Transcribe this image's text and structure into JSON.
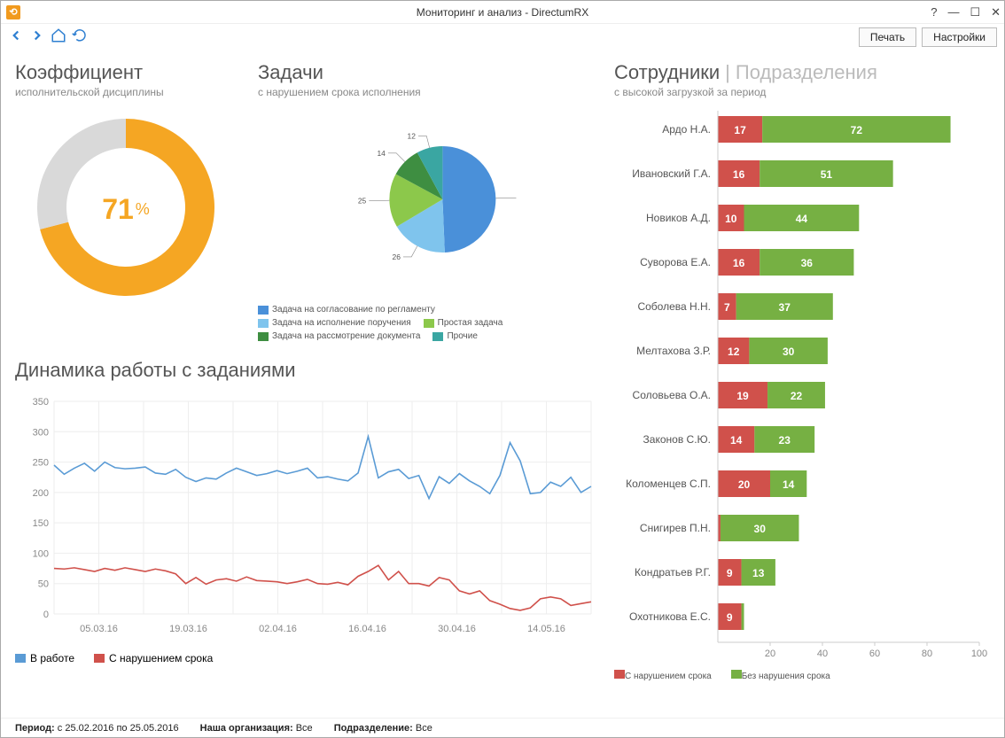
{
  "window": {
    "title": "Мониторинг и анализ - DirectumRX",
    "help": "?"
  },
  "toolbar": {
    "print": "Печать",
    "settings": "Настройки"
  },
  "donut": {
    "title": "Коэффициент",
    "subtitle": "исполнительской дисциплины",
    "value": "71",
    "pct": "%"
  },
  "pie": {
    "title": "Задачи",
    "subtitle": "с нарушением срока исполнения",
    "legend": [
      "Задача на согласование по регламенту",
      "Задача на исполнение поручения",
      "Простая задача",
      "Задача на рассмотрение документа",
      "Прочие"
    ]
  },
  "line": {
    "title": "Динамика работы с заданиями",
    "legend1": "В работе",
    "legend2": "С нарушением срока"
  },
  "employees": {
    "tab1": "Сотрудники",
    "tab2": "Подразделения",
    "subtitle": "с высокой загрузкой за период",
    "legend1": "С нарушением срока",
    "legend2": "Без нарушения срока"
  },
  "status": {
    "period_label": "Период:",
    "period_value": "с 25.02.2016 по 25.05.2016",
    "org_label": "Наша организация:",
    "org_value": "Все",
    "dept_label": "Подразделение:",
    "dept_value": "Все"
  },
  "chart_data": {
    "donut": {
      "type": "pie",
      "value": 71,
      "title": "Коэффициент исполнительской дисциплины"
    },
    "tasks_pie": {
      "type": "pie",
      "title": "Задачи с нарушением срока исполнения",
      "series": [
        {
          "name": "Задача на согласование по регламенту",
          "value": 75,
          "color": "#4a90d9"
        },
        {
          "name": "Задача на исполнение поручения",
          "value": 26,
          "color": "#7fc4ed"
        },
        {
          "name": "Простая задача",
          "value": 25,
          "color": "#8cc84b"
        },
        {
          "name": "Задача на рассмотрение документа",
          "value": 14,
          "color": "#3e8e41"
        },
        {
          "name": "Прочие",
          "value": 12,
          "color": "#3aa6a2"
        }
      ]
    },
    "dynamics": {
      "type": "line",
      "title": "Динамика работы с заданиями",
      "ylabel": "",
      "ylim": [
        0,
        350
      ],
      "yticks": [
        0,
        50,
        100,
        150,
        200,
        250,
        300,
        350
      ],
      "xticks": [
        "05.03.16",
        "19.03.16",
        "02.04.16",
        "16.04.16",
        "30.04.16",
        "14.05.16"
      ],
      "series": [
        {
          "name": "В работе",
          "color": "#5a9bd5",
          "values": [
            245,
            230,
            240,
            248,
            235,
            250,
            241,
            239,
            240,
            242,
            232,
            230,
            238,
            225,
            218,
            224,
            222,
            232,
            240,
            234,
            228,
            231,
            236,
            231,
            235,
            240,
            224,
            226,
            222,
            219,
            232,
            292,
            224,
            234,
            238,
            223,
            228,
            190,
            226,
            215,
            231,
            219,
            210,
            198,
            228,
            282,
            252,
            198,
            200,
            217,
            210,
            225,
            200,
            210
          ]
        },
        {
          "name": "С нарушением срока",
          "color": "#d0514b",
          "values": [
            75,
            74,
            76,
            73,
            70,
            75,
            72,
            76,
            73,
            70,
            74,
            71,
            66,
            50,
            60,
            49,
            56,
            58,
            54,
            61,
            55,
            54,
            53,
            50,
            53,
            57,
            50,
            49,
            52,
            48,
            62,
            70,
            80,
            56,
            70,
            50,
            50,
            46,
            60,
            56,
            38,
            33,
            38,
            22,
            16,
            9,
            6,
            10,
            25,
            28,
            25,
            14,
            17,
            20
          ]
        }
      ]
    },
    "employees_bar": {
      "type": "bar",
      "title": "Сотрудники с высокой загрузкой за период",
      "xlim": [
        0,
        100
      ],
      "xticks": [
        20,
        40,
        60,
        80,
        100
      ],
      "categories": [
        "Ардо Н.А.",
        "Ивановский Г.А.",
        "Новиков А.Д.",
        "Суворова Е.А.",
        "Соболева Н.Н.",
        "Мелтахова З.Р.",
        "Соловьева О.А.",
        "Законов С.Ю.",
        "Коломенцев С.П.",
        "Снигирев П.Н.",
        "Кондратьев Р.Г.",
        "Охотникова Е.С."
      ],
      "series": [
        {
          "name": "С нарушением срока",
          "color": "#d0514b",
          "values": [
            17,
            16,
            10,
            16,
            7,
            12,
            19,
            14,
            20,
            1,
            9,
            9
          ]
        },
        {
          "name": "Без нарушения срока",
          "color": "#76b043",
          "values": [
            72,
            51,
            44,
            36,
            37,
            30,
            22,
            23,
            14,
            30,
            13,
            1
          ]
        }
      ]
    }
  }
}
